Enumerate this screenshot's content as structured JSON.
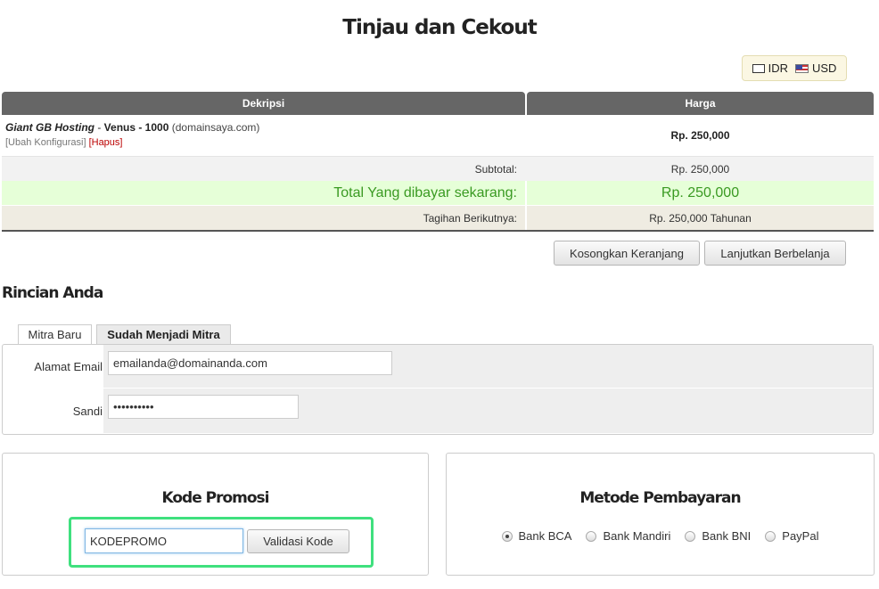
{
  "page_title": "Tinjau dan Cekout",
  "currency": {
    "options": [
      "IDR",
      "USD"
    ]
  },
  "cart": {
    "headers": {
      "description": "Dekripsi",
      "price": "Harga"
    },
    "item": {
      "product": "Giant GB Hosting",
      "separator1": " - ",
      "package": "Venus - 1000",
      "domain": " (domainsaya.com)",
      "edit_link": "[Ubah Konfigurasi]",
      "remove_link": "[Hapus]",
      "price": "Rp. 250,000"
    },
    "subtotal": {
      "label": "Subtotal:",
      "value": "Rp. 250,000"
    },
    "total_due": {
      "label": "Total Yang dibayar sekarang:",
      "value": "Rp. 250,000"
    },
    "recurring": {
      "label": "Tagihan Berikutnya:",
      "value": "Rp. 250,000 Tahunan"
    },
    "empty_button": "Kosongkan Keranjang",
    "continue_button": "Lanjutkan Berbelanja"
  },
  "details": {
    "title": "Rincian Anda",
    "tabs": [
      "Mitra Baru",
      "Sudah Menjadi Mitra"
    ],
    "email_label": "Alamat Email",
    "email_value": "emailanda@domainanda.com",
    "password_label": "Sandi",
    "password_value": "••••••••••"
  },
  "promo": {
    "title": "Kode Promosi",
    "code_value": "KODEPROMO",
    "validate_button": "Validasi Kode"
  },
  "payment": {
    "title": "Metode Pembayaran",
    "options": [
      "Bank BCA",
      "Bank Mandiri",
      "Bank BNI",
      "PayPal"
    ],
    "selected": "Bank BCA"
  },
  "colors": {
    "accent_green": "#3a9a22",
    "highlight_border": "#3fe07e",
    "header_gray": "#666666"
  }
}
